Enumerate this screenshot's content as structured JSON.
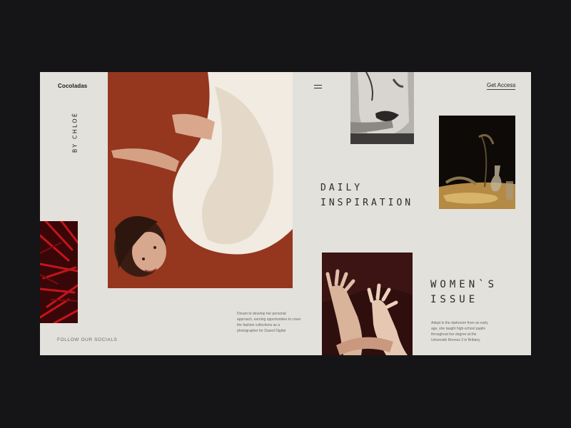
{
  "brand": {
    "logo": "Cocoladas",
    "vertical_text": "BY CHLOÉ"
  },
  "nav": {
    "menu_icon": "hamburger-icon",
    "cta_label": "Get Access"
  },
  "sections": {
    "daily_title": "DAILY\nINSPIRATION",
    "womens_title": "WOMEN`S\nISSUE"
  },
  "copy": {
    "paragraph_1": "Dream to develop her personal approach, earning opportunities to cover the fashion collections as a photographer for Dazed Digital",
    "paragraph_2": "Adept in the darkroom from an early age, she taught high-school pupils throughout her degree at the Université Rennes 2 in Brittany"
  },
  "footer": {
    "socials_label": "FOLLOW OUR SOCIALS"
  },
  "colors": {
    "background": "#151517",
    "card": "#e3e1dc",
    "hero_bg": "#95361f"
  }
}
